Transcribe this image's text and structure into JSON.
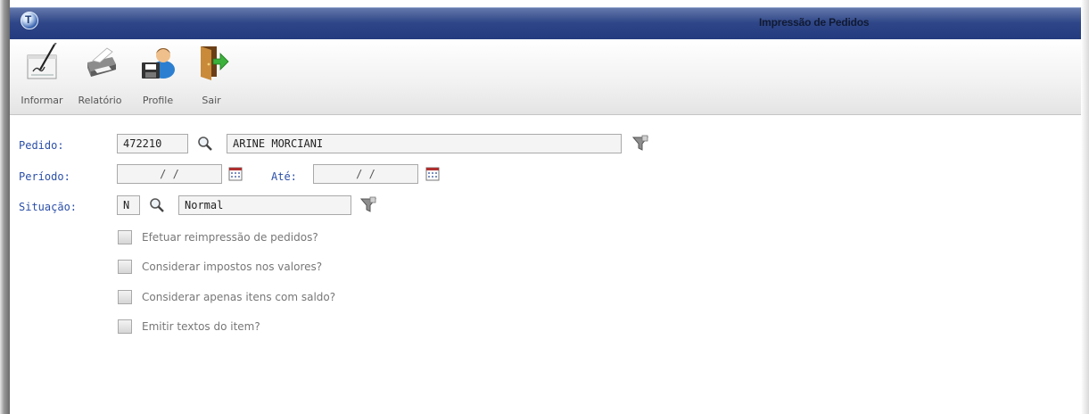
{
  "window": {
    "title": "Impressão de Pedidos"
  },
  "toolbar": {
    "informar": {
      "label": "Informar"
    },
    "relatorio": {
      "label": "Relatório"
    },
    "profile": {
      "label": "Profile"
    },
    "sair": {
      "label": "Sair"
    }
  },
  "form": {
    "pedido": {
      "label": "Pedido:",
      "code": "472210",
      "name": "ARINE MORCIANI"
    },
    "periodo": {
      "label": "Período:",
      "from": "/ /",
      "ate_label": "Até:",
      "to": "/ /"
    },
    "situacao": {
      "label": "Situação:",
      "code": "N",
      "description": "Normal"
    },
    "options": [
      {
        "label": "Efetuar reimpressão de pedidos?",
        "checked": false
      },
      {
        "label": "Considerar impostos nos valores?",
        "checked": false
      },
      {
        "label": "Considerar apenas itens com saldo?",
        "checked": false
      },
      {
        "label": "Emitir textos do item?",
        "checked": false
      }
    ]
  },
  "colors": {
    "title_bar": "#2f4788",
    "label_text": "#2b4fa8",
    "toolbar_bg": "#f1f1f1"
  }
}
